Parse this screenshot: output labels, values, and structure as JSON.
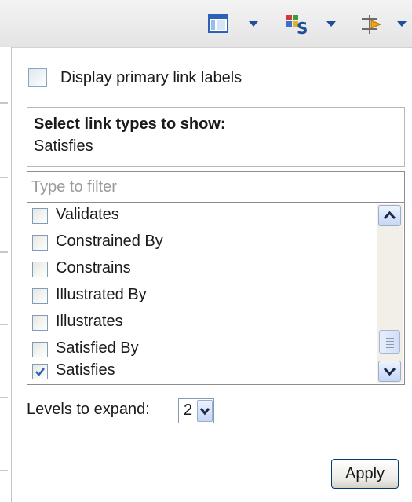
{
  "toolbar": {
    "icons": [
      "layout-icon",
      "link-types-icon",
      "link-direction-icon"
    ]
  },
  "display_primary": {
    "label": "Display primary link labels",
    "checked": false
  },
  "link_types": {
    "title": "Select link types to show:",
    "selected_summary": "Satisfies"
  },
  "filter": {
    "placeholder": "Type to filter",
    "value": ""
  },
  "list": {
    "items": [
      {
        "label": "Validates",
        "checked": false
      },
      {
        "label": "Constrained By",
        "checked": false
      },
      {
        "label": "Constrains",
        "checked": false
      },
      {
        "label": "Illustrated By",
        "checked": false
      },
      {
        "label": "Illustrates",
        "checked": false
      },
      {
        "label": "Satisfied By",
        "checked": false
      },
      {
        "label": "Satisfies",
        "checked": true
      }
    ]
  },
  "levels": {
    "label": "Levels to expand:",
    "value": "2"
  },
  "apply_label": "Apply",
  "colors": {
    "accent": "#1f4f98",
    "check": "#2f62b8"
  }
}
